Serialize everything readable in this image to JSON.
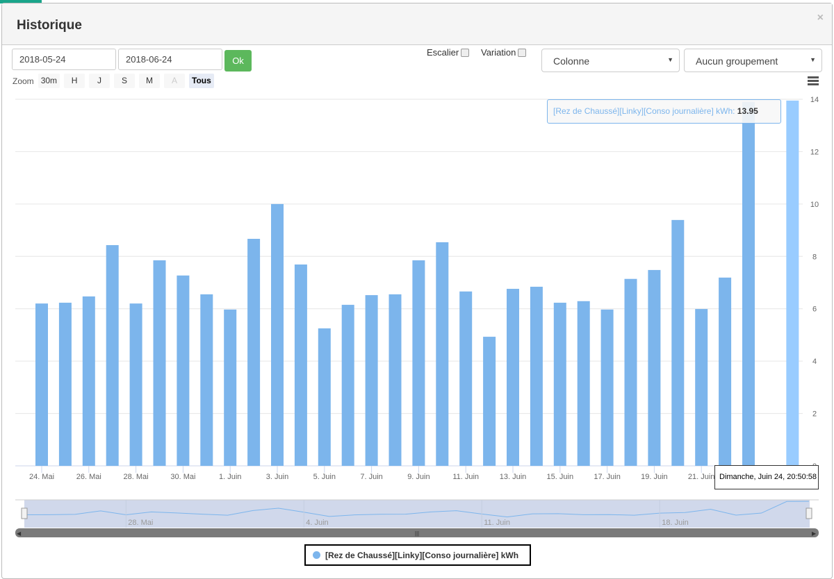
{
  "title": "Historique",
  "close_icon": "×",
  "start_date": "2018-05-24",
  "end_date": "2018-06-24",
  "ok_label": "Ok",
  "escalier_label": "Escalier",
  "variation_label": "Variation",
  "chart_type_select": "Colonne",
  "grouping_select": "Aucun groupement",
  "zoom": {
    "label": "Zoom",
    "buttons": [
      "30m",
      "H",
      "J",
      "S",
      "M",
      "A",
      "Tous"
    ],
    "active": "Tous",
    "disabled": [
      "A"
    ]
  },
  "tooltip": {
    "series": "[Rez de Chaussé][Linky][Conso journalière] kWh",
    "value": "13.95"
  },
  "x_tooltip": "Dimanche, Juin 24, 20:50:58",
  "legend": "[Rez de Chaussé][Linky][Conso journalière] kWh",
  "colors": {
    "series": "#7cb5ec",
    "hover": "#99ccff",
    "ok": "#5cb85c",
    "navigator": "#d0d8eb"
  },
  "chart_data": {
    "type": "bar",
    "series": [
      {
        "name": "[Rez de Chaussé][Linky][Conso journalière] kWh",
        "x": [
          "2018-05-24",
          "2018-05-25",
          "2018-05-26",
          "2018-05-27",
          "2018-05-28",
          "2018-05-29",
          "2018-05-30",
          "2018-05-31",
          "2018-06-01",
          "2018-06-02",
          "2018-06-03",
          "2018-06-04",
          "2018-06-05",
          "2018-06-06",
          "2018-06-07",
          "2018-06-08",
          "2018-06-09",
          "2018-06-10",
          "2018-06-11",
          "2018-06-12",
          "2018-06-13",
          "2018-06-14",
          "2018-06-15",
          "2018-06-16",
          "2018-06-17",
          "2018-06-18",
          "2018-06-19",
          "2018-06-20",
          "2018-06-21",
          "2018-06-22",
          "2018-06-23",
          "2018-06-24 20:50:58"
        ],
        "values": [
          6.2,
          6.23,
          6.47,
          8.43,
          6.2,
          7.85,
          7.27,
          6.55,
          5.97,
          8.67,
          10.0,
          7.69,
          5.25,
          6.15,
          6.52,
          6.55,
          7.85,
          8.54,
          6.66,
          4.93,
          6.76,
          6.84,
          6.23,
          6.29,
          5.97,
          7.14,
          7.48,
          9.39,
          5.99,
          7.19,
          13.9,
          13.95
        ]
      }
    ],
    "xticks": [
      "24. Mai",
      "26. Mai",
      "28. Mai",
      "30. Mai",
      "1. Juin",
      "3. Juin",
      "5. Juin",
      "7. Juin",
      "9. Juin",
      "11. Juin",
      "13. Juin",
      "15. Juin",
      "17. Juin",
      "19. Juin",
      "21. Juin"
    ],
    "yticks": [
      "0",
      "2",
      "4",
      "6",
      "8",
      "10",
      "12",
      "14"
    ],
    "ylim": [
      0,
      14
    ],
    "navigator_ticks": [
      "28. Mai",
      "4. Juin",
      "11. Juin",
      "18. Juin"
    ],
    "grid": true,
    "yaxis_side": "right"
  }
}
